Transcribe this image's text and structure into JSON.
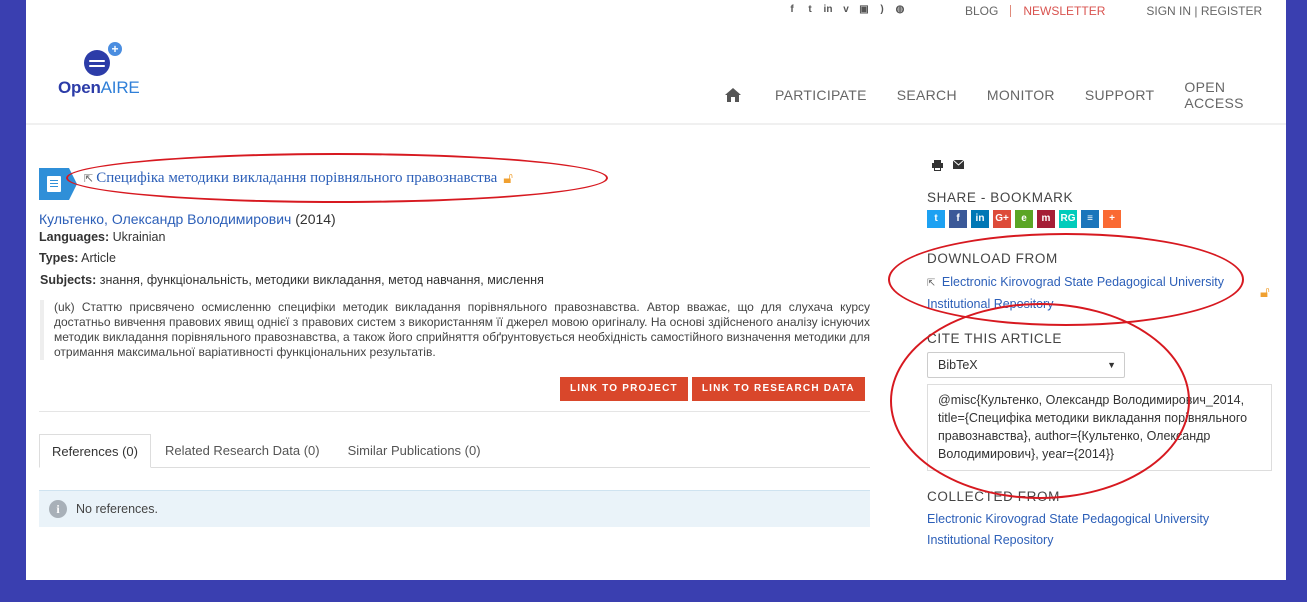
{
  "header": {
    "social_icons": [
      "facebook-icon",
      "twitter-icon",
      "linkedin-icon",
      "vimeo-icon",
      "slideshare-icon",
      "rss-icon",
      "github-icon"
    ],
    "top_links": {
      "blog": "BLOG",
      "newsletter": "NEWSLETTER",
      "auth": "SIGN IN | REGISTER"
    },
    "logo": {
      "text_open": "Open",
      "text_aire": "AIRE"
    },
    "nav": [
      "PARTICIPATE",
      "SEARCH",
      "MONITOR",
      "SUPPORT",
      "OPEN ACCESS"
    ]
  },
  "article": {
    "title": "Специфіка методики викладання порівняльного правознавства",
    "author": "Культенко, Олександр Володимирович",
    "year": "(2014)",
    "languages_label": "Languages:",
    "languages": "Ukrainian",
    "types_label": "Types:",
    "types": "Article",
    "subjects_label": "Subjects:",
    "subjects": "знання, функціональність, методики викладання, метод навчання, мислення",
    "abstract": "(uk) Статтю присвячено осмисленню специфіки методик викладання порівняльного правознавства. Автор вважає, що для слухача курсу достатньо вивчення правових явищ однієї з правових систем з використанням її джерел мовою оригіналу. На основі здійсненого аналізу існуючих методик викладання порівняльного правознавства, а також його сприйняття обґрунтовується необхідність самостійного визначення методики для отримання максимальної варіативності функціональних результатів."
  },
  "buttons": {
    "link_project": "LINK TO PROJECT",
    "link_data": "LINK TO RESEARCH DATA"
  },
  "tabs": [
    {
      "label": "References (0)"
    },
    {
      "label": "Related Research Data (0)"
    },
    {
      "label": "Similar Publications (0)"
    }
  ],
  "noref_message": "No references.",
  "sidebar": {
    "share_title": "SHARE - BOOKMARK",
    "share_icons": [
      {
        "icon": "twitter-icon",
        "glyph": "t",
        "color": "#1da1f2"
      },
      {
        "icon": "facebook-icon",
        "glyph": "f",
        "color": "#3b5998"
      },
      {
        "icon": "linkedin-icon",
        "glyph": "in",
        "color": "#0077b5"
      },
      {
        "icon": "googleplus-icon",
        "glyph": "G+",
        "color": "#dd4b39"
      },
      {
        "icon": "evernote-icon",
        "glyph": "e",
        "color": "#5ba525"
      },
      {
        "icon": "mendeley-icon",
        "glyph": "m",
        "color": "#a51e36"
      },
      {
        "icon": "researchgate-icon",
        "glyph": "RG",
        "color": "#00ccbb"
      },
      {
        "icon": "citeulike-icon",
        "glyph": "≡",
        "color": "#1b75bb"
      },
      {
        "icon": "more-icon",
        "glyph": "+",
        "color": "#fa6a33"
      }
    ],
    "download_title": "DOWNLOAD FROM",
    "download_line1": "Electronic Kirovograd State Pedagogical University",
    "download_line2": "Institutional Repository",
    "cite_title": "CITE THIS ARTICLE",
    "cite_format": "BibTeX",
    "cite_text": "@misc{Культенко, Олександр Володимирович_2014, title={Специфіка методики викладання порівняльного правознавства}, author={Культенко, Олександр Володимирович}, year={2014}}",
    "collected_title": "COLLECTED FROM",
    "collected_line1": "Electronic Kirovograd State Pedagogical University",
    "collected_line2": "Institutional Repository"
  },
  "colors": {
    "accent_link": "#2c5fb8",
    "button": "#d9472b",
    "annotation": "#d71920",
    "frame": "#3a3fb0"
  }
}
